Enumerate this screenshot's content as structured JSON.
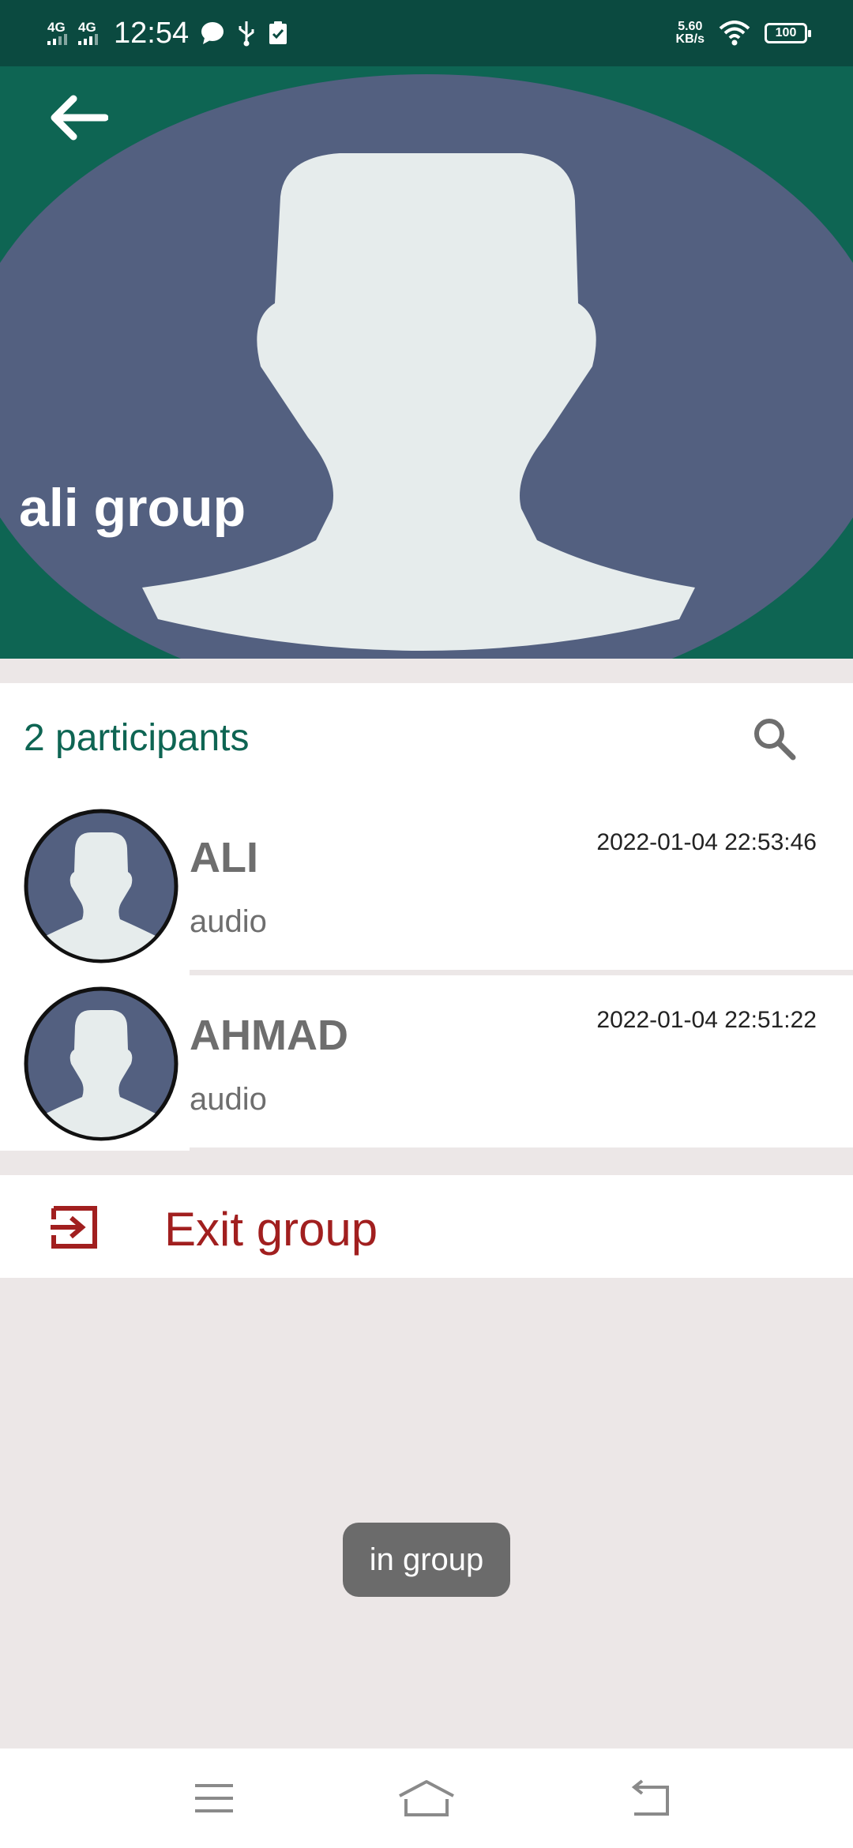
{
  "status_bar": {
    "network_1": "4G",
    "network_2": "4G",
    "time": "12:54",
    "speed_value": "5.60",
    "speed_unit": "KB/s",
    "battery": "100"
  },
  "header": {
    "title": "ali group"
  },
  "participants": {
    "count_label": "2 participants",
    "items": [
      {
        "name": "ALI",
        "status": "audio",
        "timestamp": "2022-01-04 22:53:46"
      },
      {
        "name": "AHMAD",
        "status": "audio",
        "timestamp": "2022-01-04 22:51:22"
      }
    ]
  },
  "actions": {
    "exit_label": "Exit group"
  },
  "toast": {
    "text": "in group"
  },
  "colors": {
    "header_green": "#0e6553",
    "status_bar": "#0b4a40",
    "avatar_bg": "#536080",
    "avatar_figure": "#e6ecec",
    "exit_red": "#a11f1f",
    "page_bg": "#ece7e7"
  },
  "icons": [
    "back-arrow-icon",
    "search-icon",
    "exit-icon",
    "menu-icon",
    "home-icon",
    "return-icon"
  ]
}
